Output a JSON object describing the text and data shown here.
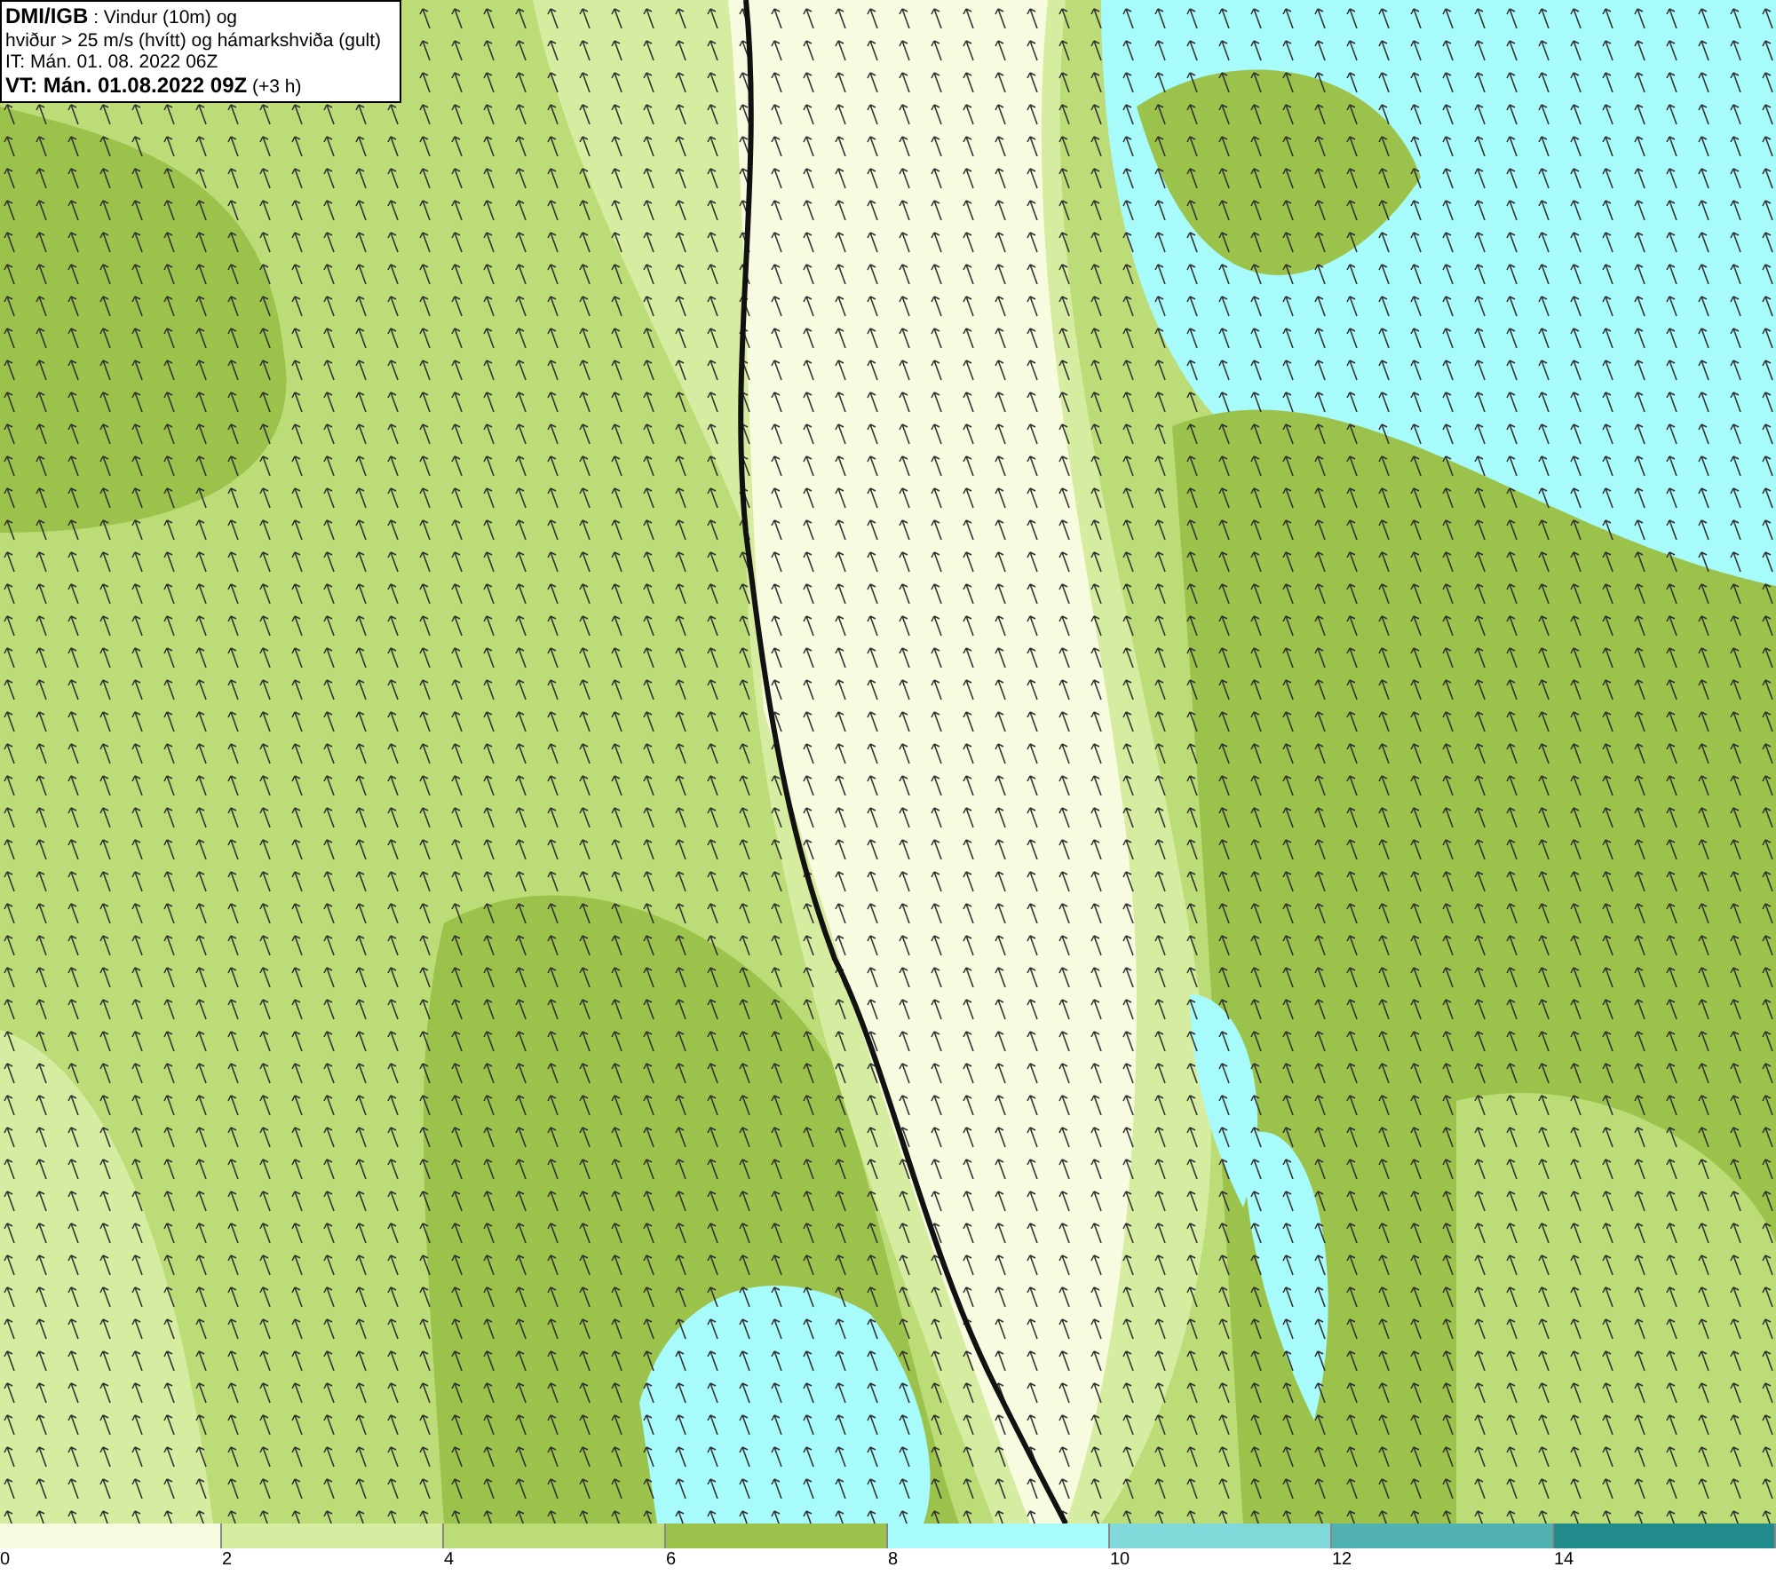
{
  "title_box": {
    "lines": [
      "**DMI/IGB** : Vindur (10m) og",
      "hviður > 25 m/s (hvítt) og hámarkshviða (gult)",
      "IT: Mán. 01. 08. 2022 06Z",
      "**VT: Mán. 01.08.2022 09Z** (+3 h)"
    ]
  },
  "legend": {
    "bins": [
      {
        "color": "#f7fbdf"
      },
      {
        "color": "#d6eca0"
      },
      {
        "color": "#bcdc78"
      },
      {
        "color": "#9bc24a"
      },
      {
        "color": "#a8fbfb"
      },
      {
        "color": "#80d8d8"
      },
      {
        "color": "#52b1b1"
      },
      {
        "color": "#228c8c"
      }
    ],
    "ticks": [
      "0",
      "2",
      "4",
      "6",
      "8",
      "10",
      "12",
      "14"
    ]
  }
}
